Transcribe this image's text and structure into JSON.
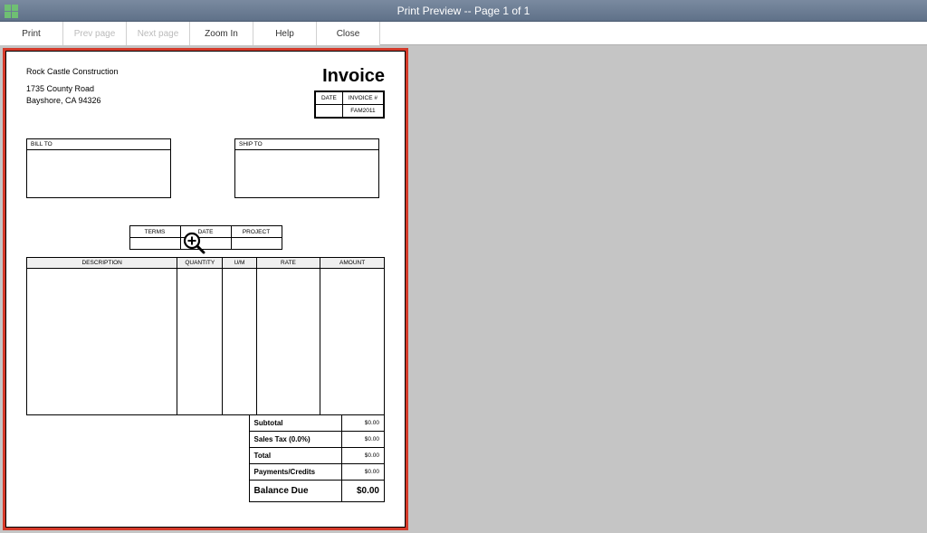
{
  "window": {
    "title": "Print Preview -- Page 1 of 1"
  },
  "toolbar": {
    "print": "Print",
    "prev": "Prev page",
    "next": "Next page",
    "zoom": "Zoom In",
    "help": "Help",
    "close": "Close"
  },
  "company": {
    "name": "Rock Castle Construction",
    "addr1": "1735 County Road",
    "addr2": "Bayshore, CA 94326"
  },
  "invoice": {
    "title": "Invoice",
    "date_h": "DATE",
    "num_h": "INVOICE #",
    "num_val": "FAM2011"
  },
  "addr": {
    "bill": "BILL TO",
    "ship": "SHIP TO"
  },
  "tdp": {
    "terms": "TERMS",
    "date": "DATE",
    "project": "PROJECT"
  },
  "cols": {
    "desc": "DESCRIPTION",
    "qty": "QUANTITY",
    "um": "U/M",
    "rate": "RATE",
    "amt": "AMOUNT"
  },
  "totals": {
    "subtotal_l": "Subtotal",
    "subtotal_v": "$0.00",
    "tax_l": "Sales Tax  (0.0%)",
    "tax_v": "$0.00",
    "total_l": "Total",
    "total_v": "$0.00",
    "pay_l": "Payments/Credits",
    "pay_v": "$0.00",
    "bal_l": "Balance Due",
    "bal_v": "$0.00"
  }
}
